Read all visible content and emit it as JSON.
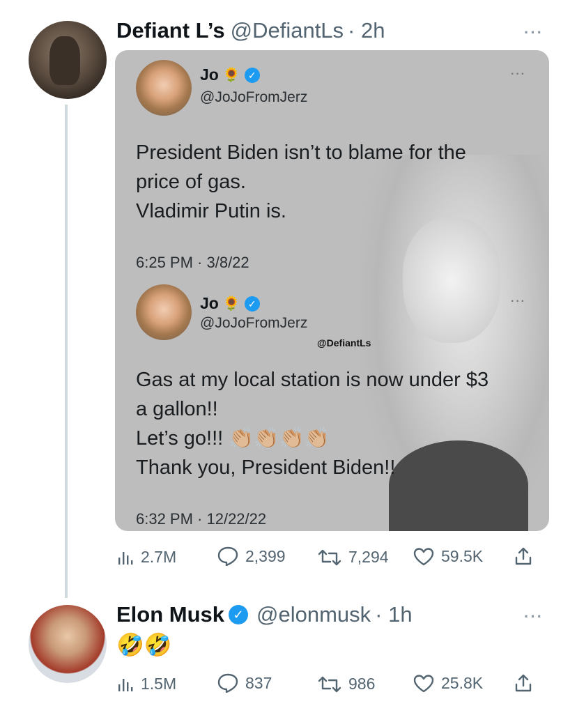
{
  "tweet1": {
    "name": "Defiant L’s",
    "handle": "@DefiantLs",
    "time": "· 2h",
    "more": "···",
    "quoted": {
      "jo_name": "Jo",
      "jo_emoji": "🌻",
      "jo_handle": "@JoJoFromJerz",
      "text1": "President Biden isn’t to blame for the\nprice of gas.\nVladimir Putin is.",
      "time1": "6:25 PM · 3/8/22",
      "more": "···",
      "watermark": "@DefiantLs",
      "text2": "Gas at my local station is now under $3\na gallon!!\nLet’s go!!! 👏🏼👏🏼👏🏼👏🏼\nThank you, President Biden!!",
      "time2": "6:32 PM · 12/22/22"
    },
    "stats": {
      "views": "2.7M",
      "replies": "2,399",
      "retweets": "7,294",
      "likes": "59.5K"
    }
  },
  "tweet2": {
    "name": "Elon Musk",
    "handle": "@elonmusk",
    "time": "· 1h",
    "more": "···",
    "text": "🤣🤣",
    "stats": {
      "views": "1.5M",
      "replies": "837",
      "retweets": "986",
      "likes": "25.8K"
    }
  },
  "colors": {
    "verified": "#1d9bf0",
    "muted": "#536471",
    "thread_line": "#cfd9de"
  }
}
